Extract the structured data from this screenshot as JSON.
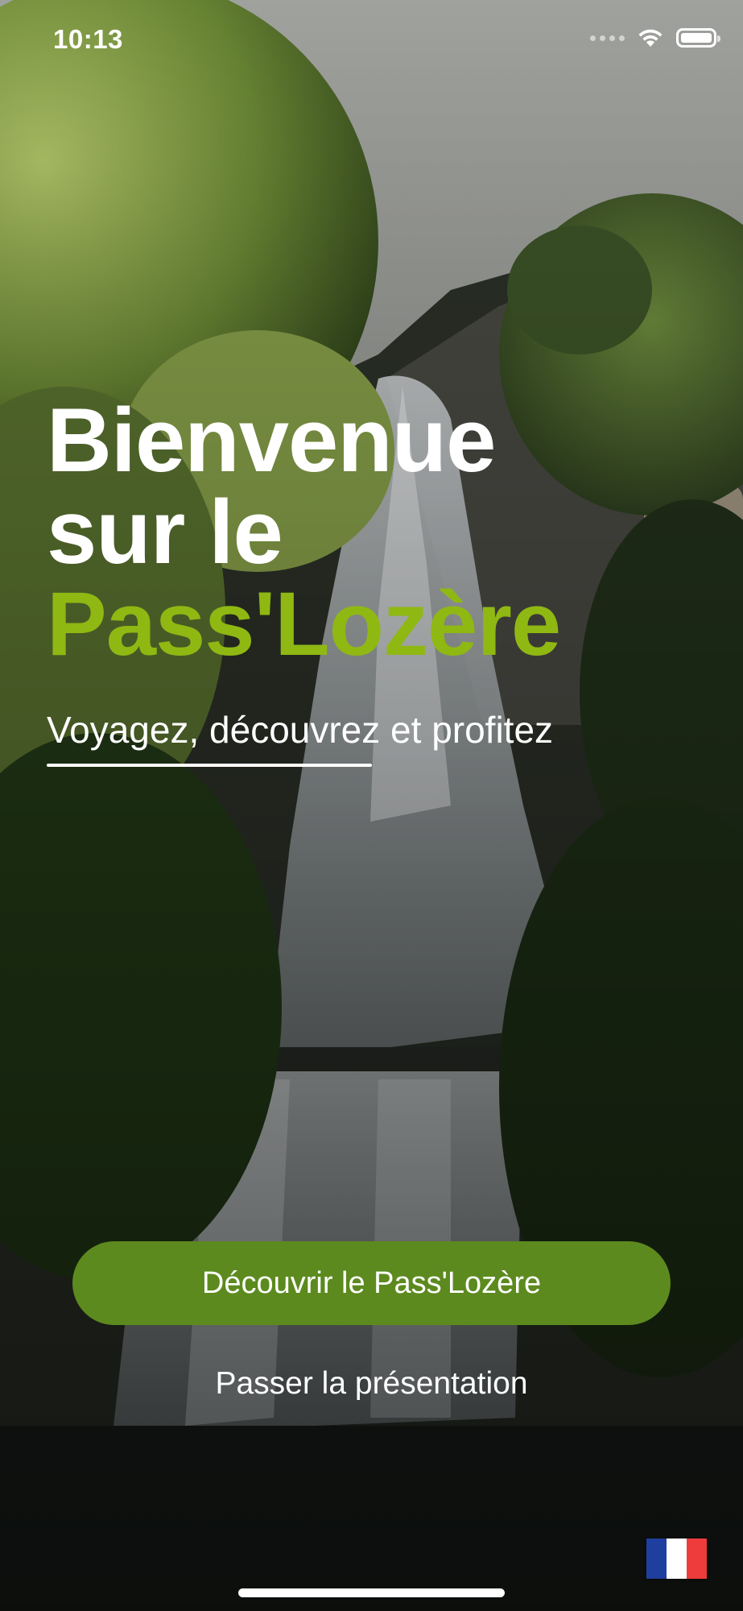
{
  "status_bar": {
    "time": "10:13",
    "icons": [
      "cellular-signal-icon",
      "wifi-icon",
      "battery-icon"
    ]
  },
  "hero": {
    "title_line_1": "Bienvenue",
    "title_line_2": "sur le",
    "title_brand": "Pass'Lozère",
    "subtitle": "Voyagez, découvrez et profitez"
  },
  "actions": {
    "primary_label": "Découvrir le Pass'Lozère",
    "skip_label": "Passer la présentation"
  },
  "language": {
    "flag_icon": "france-flag-icon"
  },
  "colors": {
    "brand_green": "#8fb813",
    "button_green": "#5c8a1e",
    "text": "#ffffff"
  }
}
